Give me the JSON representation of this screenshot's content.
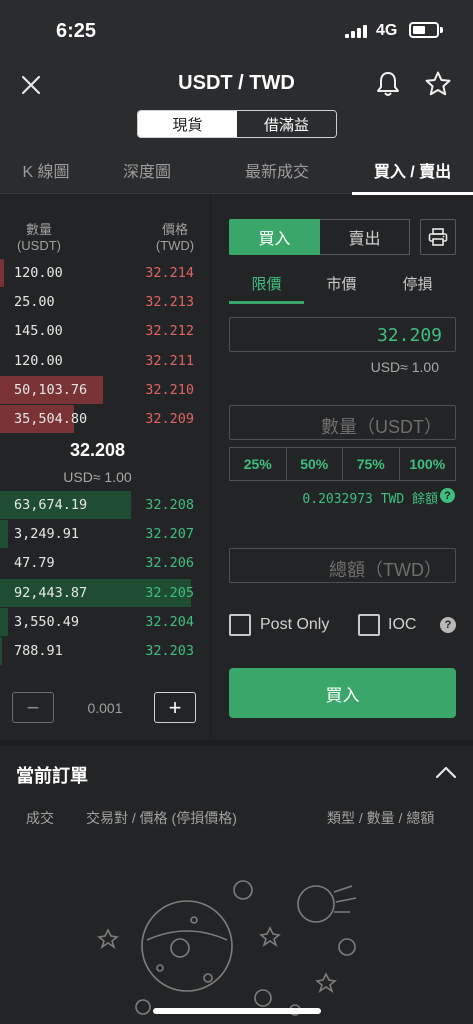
{
  "status_bar": {
    "time": "6:25",
    "network": "4G"
  },
  "header": {
    "title": "USDT / TWD",
    "segments": [
      "現貨",
      "借滿益"
    ]
  },
  "tabs": [
    "K 線圖",
    "深度圖",
    "最新成交",
    "買入 / 賣出"
  ],
  "order_book": {
    "qty_header": "數量\n(USDT)",
    "qty_header_line1": "數量",
    "qty_header_line2": "(USDT)",
    "price_header_line1": "價格",
    "price_header_line2": "(TWD)",
    "asks": [
      {
        "qty": "120.00",
        "price": "32.214",
        "depth": 0.02
      },
      {
        "qty": "25.00",
        "price": "32.213",
        "depth": 0.0
      },
      {
        "qty": "145.00",
        "price": "32.212",
        "depth": 0.0
      },
      {
        "qty": "120.00",
        "price": "32.211",
        "depth": 0.0
      },
      {
        "qty": "50,103.76",
        "price": "32.210",
        "depth": 0.53
      },
      {
        "qty": "35,504.80",
        "price": "32.209",
        "depth": 0.38
      }
    ],
    "mid_price": "32.208",
    "mid_usd": "USD≈ 1.00",
    "bids": [
      {
        "qty": "63,674.19",
        "price": "32.208",
        "depth": 0.67
      },
      {
        "qty": "3,249.91",
        "price": "32.207",
        "depth": 0.04
      },
      {
        "qty": "47.79",
        "price": "32.206",
        "depth": 0.0
      },
      {
        "qty": "92,443.87",
        "price": "32.205",
        "depth": 0.98
      },
      {
        "qty": "3,550.49",
        "price": "32.204",
        "depth": 0.04
      },
      {
        "qty": "788.91",
        "price": "32.203",
        "depth": 0.01
      }
    ],
    "step_value": "0.001",
    "step_minus": "−",
    "step_plus": "+"
  },
  "trade_panel": {
    "buy_tab": "買入",
    "sell_tab": "賣出",
    "order_types": [
      "限價",
      "市價",
      "停損"
    ],
    "price_value": "32.209",
    "price_usd": "USD≈ 1.00",
    "qty_placeholder": "數量（USDT）",
    "percents": [
      "25%",
      "50%",
      "75%",
      "100%"
    ],
    "balance": "0.2032973 TWD 餘額",
    "total_placeholder": "總額（TWD）",
    "post_only_label": "Post Only",
    "ioc_label": "IOC",
    "help_glyph": "?",
    "submit_label": "買入"
  },
  "orders": {
    "title": "當前訂單",
    "col_fill": "成交",
    "col_pair": "交易對 / 價格 (停損價格)",
    "col_type": "類型 / 數量 / 總額"
  },
  "colors": {
    "accent_green": "#3aa66a",
    "ask_red": "#e06464",
    "bid_green": "#3fbf7f",
    "background": "#232425"
  },
  "icons": [
    "close-icon",
    "bell-icon",
    "star-icon",
    "printer-icon",
    "chevron-up-icon",
    "help-icon"
  ]
}
